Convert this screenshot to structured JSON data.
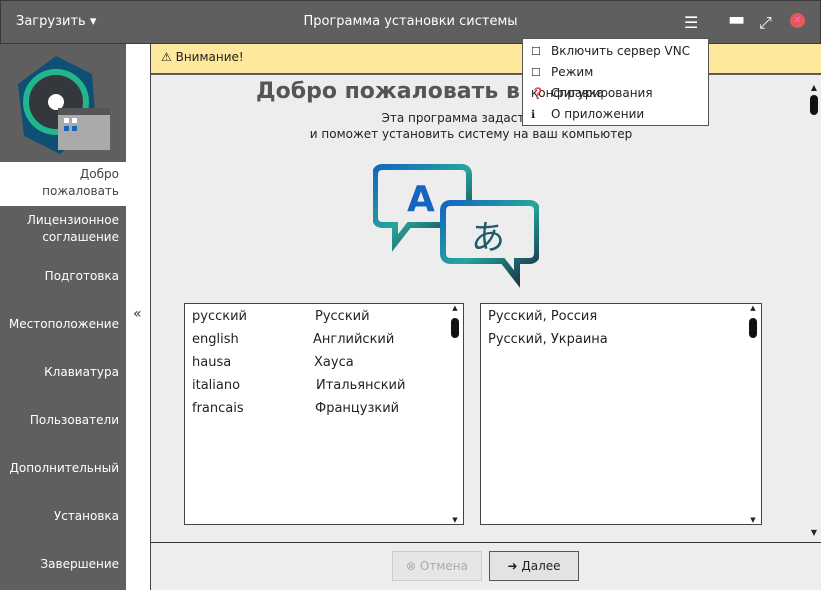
{
  "titlebar": {
    "load_label": "Загрузить",
    "title": "Программа установки системы"
  },
  "sidebar": {
    "items": [
      "Добро пожаловать",
      "Лицензионное соглашение",
      "Подготовка",
      "Местоположение",
      "Клавиатура",
      "Пользователи",
      "Дополнительный",
      "Установка",
      "Завершение"
    ],
    "collapse": "«"
  },
  "warning": {
    "text": "Внимание!"
  },
  "main": {
    "heading": "Добро пожаловать в уст",
    "subtitle_line1": "Эта программа задаст вам неск",
    "subtitle_line2": "и поможет установить систему на ваш компьютер"
  },
  "languages": [
    [
      "русский",
      "Русский"
    ],
    [
      "english",
      "Английский"
    ],
    [
      "hausa",
      "Хауса"
    ],
    [
      "italiano",
      "Итальянский"
    ],
    [
      "francais",
      "Французкий"
    ]
  ],
  "locales": [
    "Русский, Россия",
    "Русский, Украина"
  ],
  "menu": {
    "items": [
      "Включить сервер VNC",
      "Режим конфигурирования",
      "Справка",
      "О приложении"
    ]
  },
  "footer": {
    "cancel": "Отмена",
    "next": "Далее"
  },
  "colors": {
    "accent_close": "#e05a5a",
    "warning_bg": "#fde89b"
  }
}
